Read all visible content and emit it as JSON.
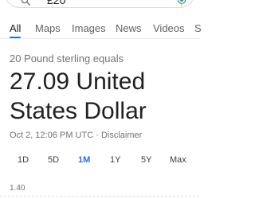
{
  "search": {
    "query": "£20"
  },
  "tabs": [
    {
      "label": "All",
      "active": true
    },
    {
      "label": "Maps"
    },
    {
      "label": "Images"
    },
    {
      "label": "News"
    },
    {
      "label": "Videos"
    },
    {
      "label": "S"
    }
  ],
  "conversion": {
    "equals_label": "20 Pound sterling equals",
    "value_text": "27.09 United States Dollar",
    "timestamp": "Oct 2, 12:06 PM UTC",
    "separator": "·",
    "disclaimer": "Disclaimer"
  },
  "range_tabs": [
    {
      "label": "1D"
    },
    {
      "label": "5D"
    },
    {
      "label": "1M",
      "selected": true
    },
    {
      "label": "1Y"
    },
    {
      "label": "5Y"
    },
    {
      "label": "Max"
    }
  ],
  "chart": {
    "y_tick_label": "1.40"
  },
  "colors": {
    "accent": "#1a73e8",
    "text": "#202124",
    "muted": "#70757a"
  },
  "icons": {
    "search": "search-icon",
    "mic": "microphone-icon"
  }
}
